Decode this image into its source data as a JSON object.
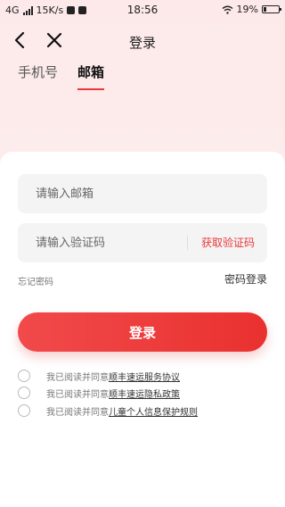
{
  "status_bar": {
    "network": "4G",
    "speed": "15K/s",
    "time": "18:56",
    "battery": "19%",
    "battery_level": 0.19
  },
  "nav": {
    "title": "登录"
  },
  "tabs": [
    {
      "label": "手机号",
      "active": false
    },
    {
      "label": "邮箱",
      "active": true
    }
  ],
  "form": {
    "email_placeholder": "请输入邮箱",
    "code_placeholder": "请输入验证码",
    "get_code_label": "获取验证码",
    "forgot_label": "忘记密码",
    "password_login_label": "密码登录",
    "login_label": "登录"
  },
  "agreements": [
    {
      "prefix": "我已阅读并同意",
      "link": "顺丰速运服务协议"
    },
    {
      "prefix": "我已阅读并同意",
      "link": "顺丰速运隐私政策"
    },
    {
      "prefix": "我已阅读并同意",
      "link": "儿童个人信息保护规则"
    }
  ],
  "colors": {
    "accent": "#e8393d",
    "header_bg": "#fdecec"
  }
}
